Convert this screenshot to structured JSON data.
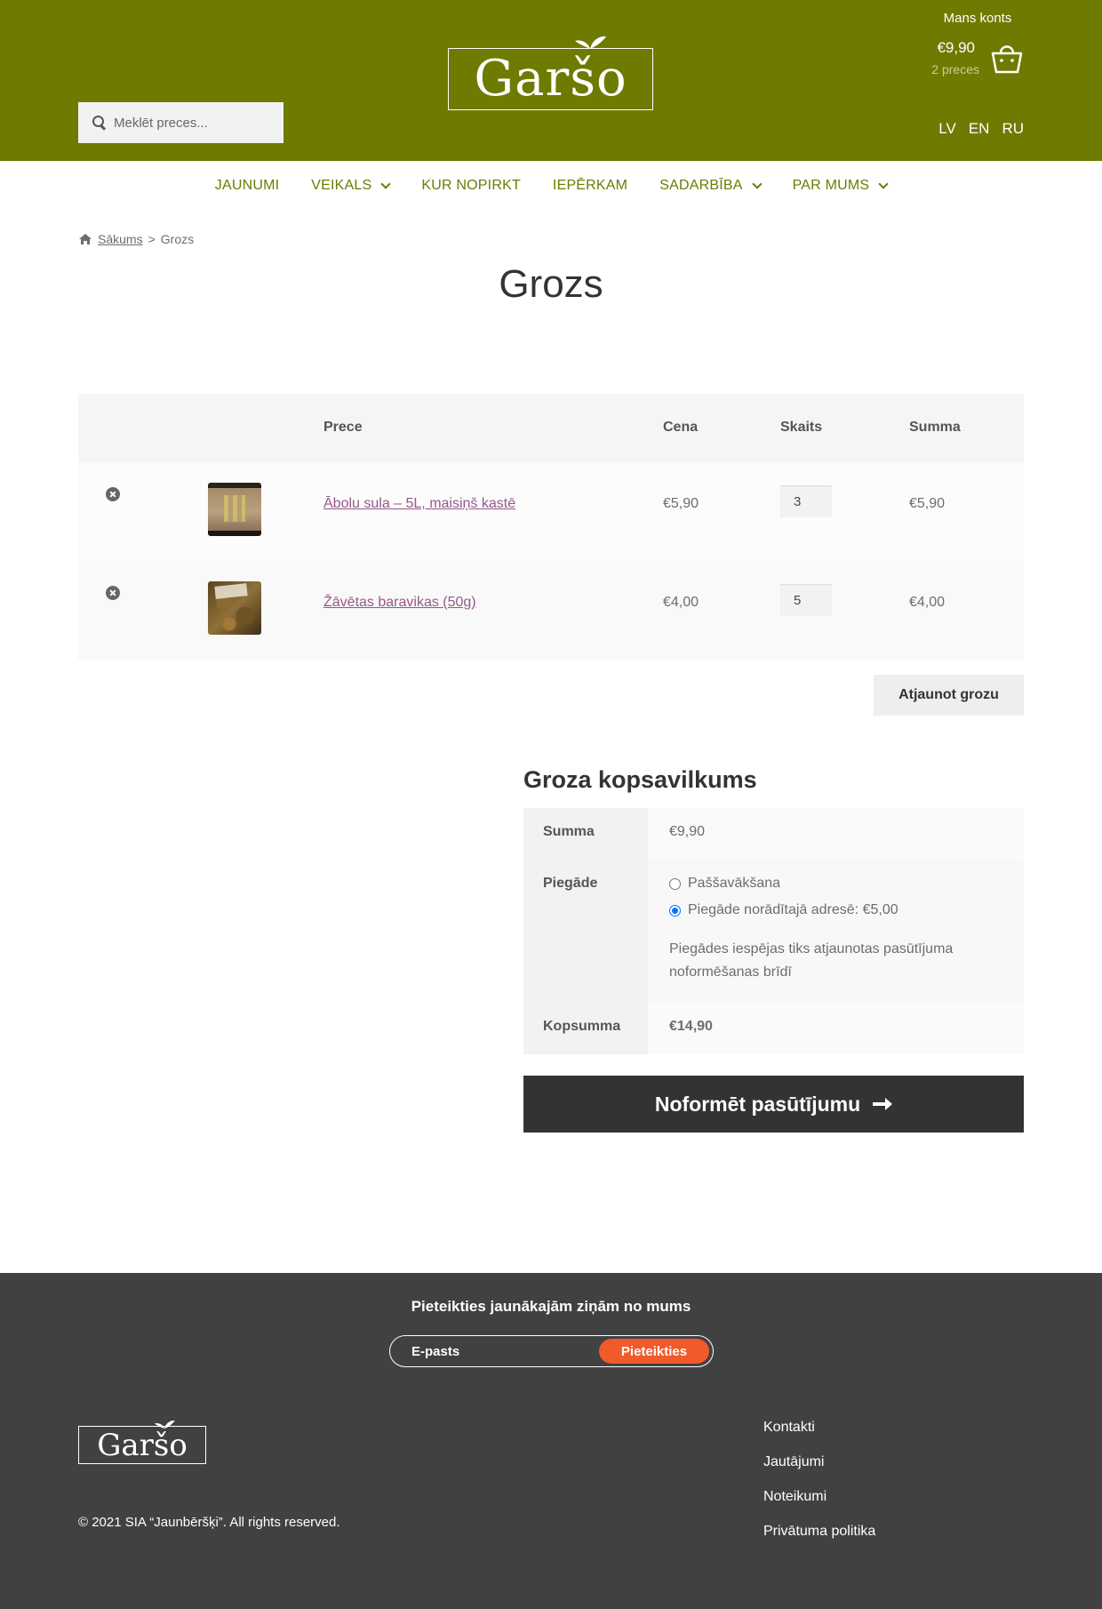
{
  "header": {
    "search_placeholder": "Meklēt preces...",
    "logo_text": "Garšo",
    "account_label": "Mans konts",
    "cart_total": "€9,90",
    "cart_count": "2 preces",
    "languages": [
      "LV",
      "EN",
      "RU"
    ]
  },
  "nav": {
    "items": [
      {
        "label": "JAUNUMI"
      },
      {
        "label": "VEIKALS"
      },
      {
        "label": "KUR NOPIRKT"
      },
      {
        "label": "IEPĒRKAM"
      },
      {
        "label": "SADARBĪBA"
      },
      {
        "label": "PAR MUMS"
      }
    ]
  },
  "breadcrumb": {
    "home": "Sākums",
    "separator": ">",
    "current": "Grozs"
  },
  "page_title": "Grozs",
  "cart": {
    "headers": {
      "product": "Prece",
      "price": "Cena",
      "quantity": "Skaits",
      "subtotal": "Summa"
    },
    "rows": [
      {
        "name": "Ābolu sula – 5L, maisiņš kastē",
        "price": "€5,90",
        "qty": "3",
        "subtotal": "€5,90"
      },
      {
        "name": "Žāvētas baravikas (50g)",
        "price": "€4,00",
        "qty": "5",
        "subtotal": "€4,00"
      }
    ],
    "update_label": "Atjaunot grozu"
  },
  "summary": {
    "title": "Groza kopsavilkums",
    "subtotal_label": "Summa",
    "subtotal_value": "€9,90",
    "shipping_label": "Piegāde",
    "shipping_options": [
      {
        "label": "Paššavākšana",
        "selected": false
      },
      {
        "label": "Piegāde norādītajā adresē: €5,00",
        "selected": true
      }
    ],
    "shipping_note": "Piegādes iespējas tiks atjaunotas pasūtījuma noformēšanas brīdī",
    "total_label": "Kopsumma",
    "total_value": "€14,90",
    "checkout_label": "Noformēt pasūtījumu"
  },
  "footer": {
    "newsletter_title": "Pieteikties jaunākajām ziņām no mums",
    "email_placeholder": "E-pasts",
    "subscribe_label": "Pieteikties",
    "logo_text": "Garšo",
    "copyright": "© 2021 SIA “Jaunbēršķi”. All rights reserved.",
    "links": [
      "Kontakti",
      "Jautājumi",
      "Noteikumi",
      "Privātuma politika"
    ]
  },
  "colors": {
    "brand_green": "#6e7a00",
    "footer_bg": "#414141",
    "accent_orange": "#f15a2b",
    "link_purple": "#96588a",
    "button_dark": "#333333"
  }
}
